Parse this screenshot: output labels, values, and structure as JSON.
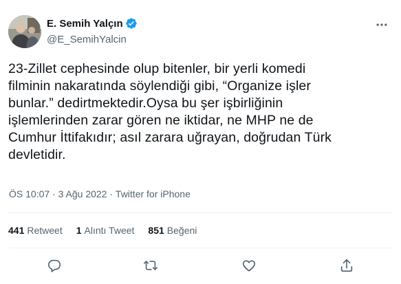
{
  "author": {
    "name": "E. Semih Yalçın",
    "handle": "@E_SemihYalcin",
    "verified": true
  },
  "tweet": {
    "text": "23-Zillet cephesinde olup bitenler, bir yerli komedi\nfilminin nakaratında söylendiği gibi, “Organize işler\nbunlar.” dedirtmektedir.Oysa bu şer işbirliğinin\nişlemlerinden zarar gören ne iktidar, ne MHP ne de\nCumhur İttifakıdır; asıl zarara uğrayan, doğrudan Türk\ndevletidir.",
    "time": "ÖS 10:07",
    "date": "3 Ağu 2022",
    "dot": "·",
    "source": "Twitter for iPhone"
  },
  "stats": {
    "retweets_count": "441",
    "retweets_label": "Retweet",
    "quotes_count": "1",
    "quotes_label": "Alıntı Tweet",
    "likes_count": "851",
    "likes_label": "Beğeni"
  },
  "icons": {
    "reply": "reply-icon",
    "retweet": "retweet-icon",
    "like": "like-icon",
    "share": "share-icon",
    "more": "more-icon",
    "verified": "verified-badge-icon"
  },
  "colors": {
    "verified": "#1d9bf0",
    "text": "#0f1419",
    "secondary": "#536471",
    "divider": "#eff3f4"
  }
}
